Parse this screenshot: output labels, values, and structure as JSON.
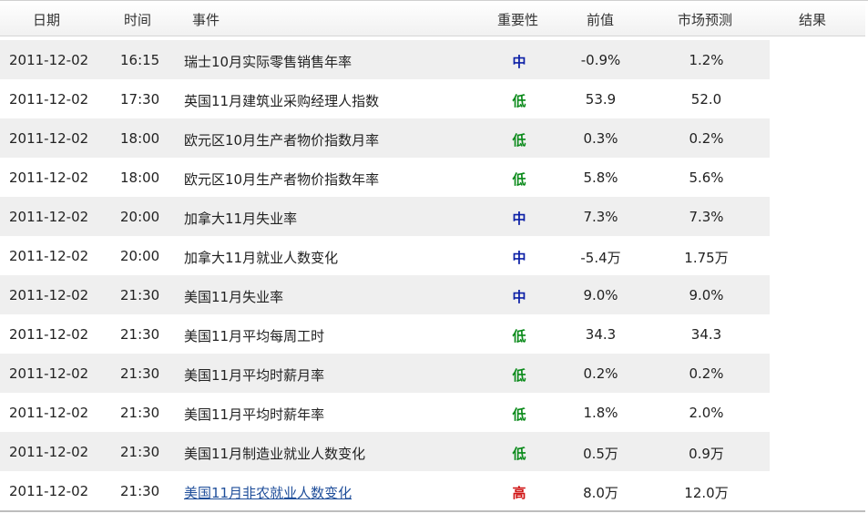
{
  "table": {
    "headers": {
      "date": "日期",
      "time": "时间",
      "event": "事件",
      "importance": "重要性",
      "previous": "前值",
      "forecast": "市场预测",
      "result": "结果"
    },
    "rows": [
      {
        "date": "2011-12-02",
        "time": "16:15",
        "event": "瑞士10月实际零售销售年率",
        "importance": "中",
        "previous": "-0.9%",
        "forecast": "1.2%"
      },
      {
        "date": "2011-12-02",
        "time": "17:30",
        "event": "英国11月建筑业采购经理人指数",
        "importance": "低",
        "previous": "53.9",
        "forecast": "52.0"
      },
      {
        "date": "2011-12-02",
        "time": "18:00",
        "event": "欧元区10月生产者物价指数月率",
        "importance": "低",
        "previous": "0.3%",
        "forecast": "0.2%"
      },
      {
        "date": "2011-12-02",
        "time": "18:00",
        "event": "欧元区10月生产者物价指数年率",
        "importance": "低",
        "previous": "5.8%",
        "forecast": "5.6%"
      },
      {
        "date": "2011-12-02",
        "time": "20:00",
        "event": "加拿大11月失业率",
        "importance": "中",
        "previous": "7.3%",
        "forecast": "7.3%"
      },
      {
        "date": "2011-12-02",
        "time": "20:00",
        "event": "加拿大11月就业人数变化",
        "importance": "中",
        "previous": "-5.4万",
        "forecast": "1.75万"
      },
      {
        "date": "2011-12-02",
        "time": "21:30",
        "event": "美国11月失业率",
        "importance": "中",
        "previous": "9.0%",
        "forecast": "9.0%"
      },
      {
        "date": "2011-12-02",
        "time": "21:30",
        "event": "美国11月平均每周工时",
        "importance": "低",
        "previous": "34.3",
        "forecast": "34.3"
      },
      {
        "date": "2011-12-02",
        "time": "21:30",
        "event": "美国11月平均时薪月率",
        "importance": "低",
        "previous": "0.2%",
        "forecast": "0.2%"
      },
      {
        "date": "2011-12-02",
        "time": "21:30",
        "event": "美国11月平均时薪年率",
        "importance": "低",
        "previous": "1.8%",
        "forecast": "2.0%"
      },
      {
        "date": "2011-12-02",
        "time": "21:30",
        "event": "美国11月制造业就业人数变化",
        "importance": "低",
        "previous": "0.5万",
        "forecast": "0.9万"
      },
      {
        "date": "2011-12-02",
        "time": "21:30",
        "event": "美国11月非农就业人数变化",
        "importance": "高",
        "previous": "8.0万",
        "forecast": "12.0万",
        "is_link": true
      }
    ]
  },
  "colors": {
    "importance_mid": "#0b1fa6",
    "importance_low": "#0a8a1a",
    "importance_high": "#d01515",
    "row_shade": "#efefef",
    "link": "#1f4e9a"
  }
}
